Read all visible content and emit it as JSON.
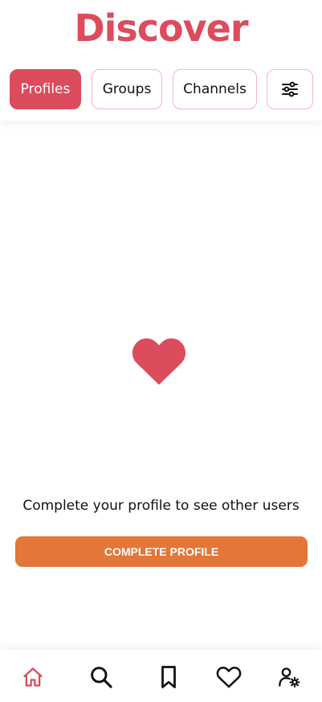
{
  "header": {
    "title": "Discover",
    "tabs": [
      {
        "label": "Profiles",
        "active": true
      },
      {
        "label": "Groups",
        "active": false
      },
      {
        "label": "Channels",
        "active": false
      }
    ],
    "filter_icon": "sliders-icon"
  },
  "main": {
    "icon": "heart-icon",
    "message": "Complete your profile to see other users",
    "button_label": "COMPLETE PROFILE"
  },
  "bottom_nav": {
    "items": [
      {
        "icon": "home-icon",
        "active": true
      },
      {
        "icon": "search-icon",
        "active": false
      },
      {
        "icon": "bookmark-icon",
        "active": false
      },
      {
        "icon": "heart-outline-icon",
        "active": false
      },
      {
        "icon": "account-settings-icon",
        "active": false
      }
    ]
  },
  "colors": {
    "brand": "#dc4c5c",
    "cta": "#e37638",
    "tab_border": "#f3b6c1"
  }
}
